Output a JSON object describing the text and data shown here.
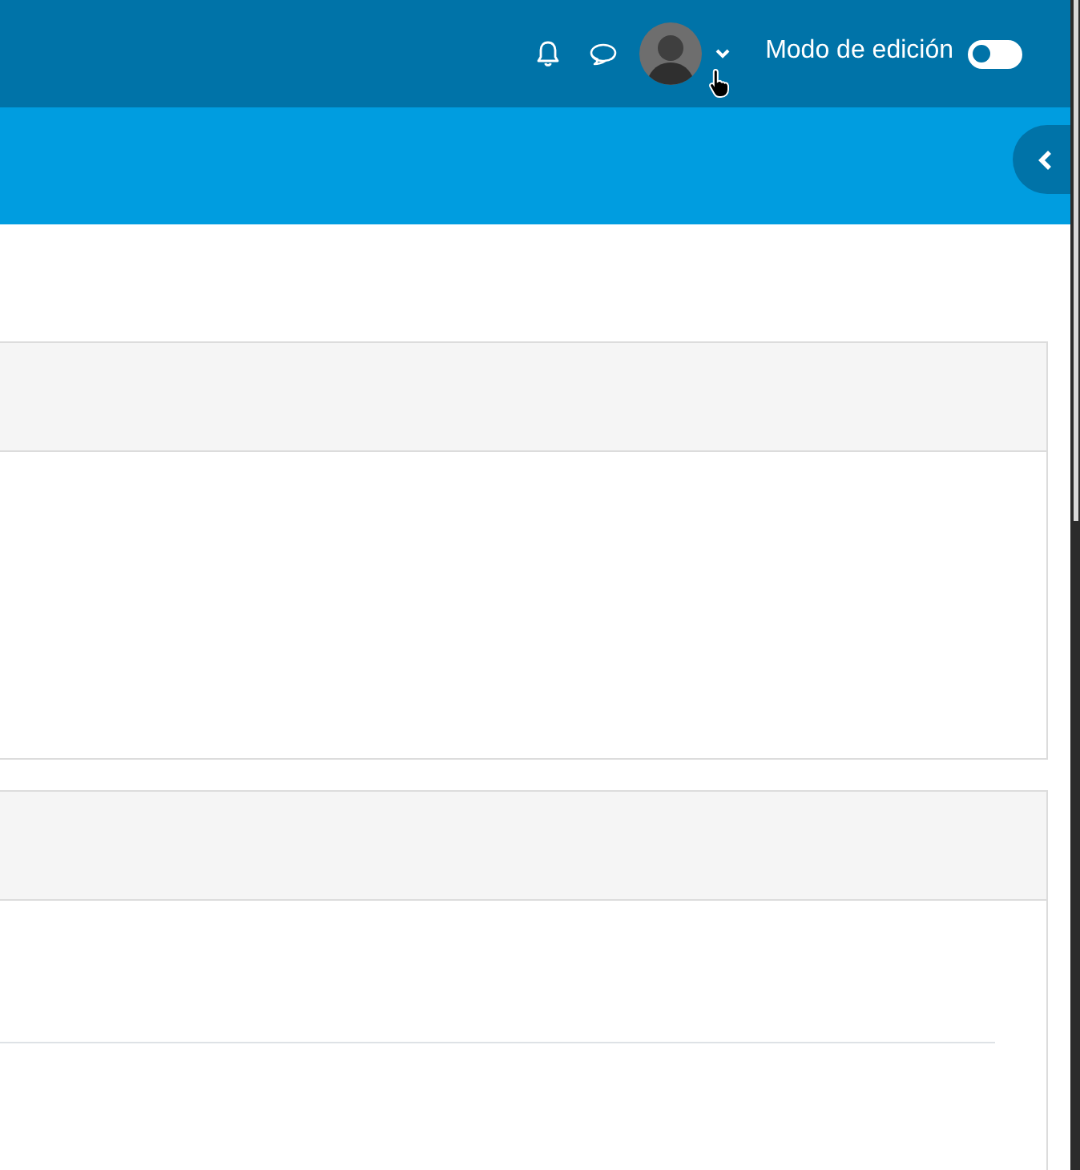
{
  "navbar": {
    "notifications": {
      "kind": "bell"
    },
    "messages": {
      "kind": "chat"
    },
    "user_menu": {
      "expanded": false
    },
    "edit_mode": {
      "label": "Modo de edición",
      "on": false
    }
  },
  "drawer_toggle": {
    "kind": "collapse"
  }
}
